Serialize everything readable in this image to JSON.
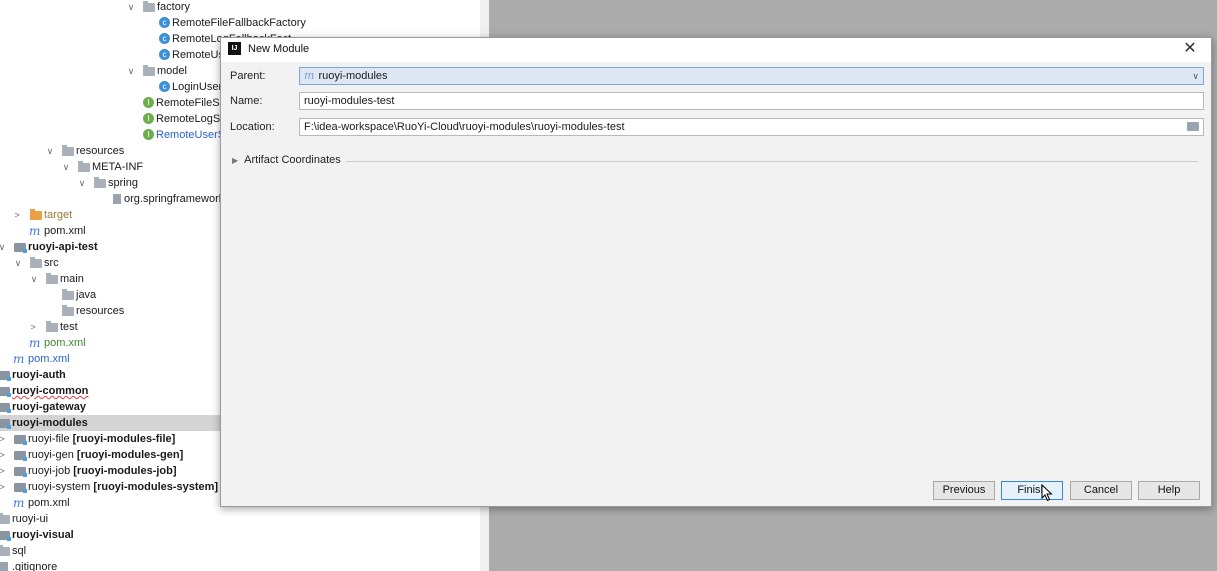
{
  "tree": {
    "rows": [
      {
        "label": "factory"
      },
      {
        "label": "RemoteFileFallbackFactory"
      },
      {
        "label": "RemoteLogFallbackFact"
      },
      {
        "label": "RemoteUs"
      },
      {
        "label": "model"
      },
      {
        "label": "LoginUser"
      },
      {
        "label": "RemoteFileSer"
      },
      {
        "label": "RemoteLogSe"
      },
      {
        "label": "RemoteUserS"
      },
      {
        "label": "resources"
      },
      {
        "label": "META-INF"
      },
      {
        "label": "spring"
      },
      {
        "label": "org.springframework"
      },
      {
        "label": "target"
      },
      {
        "label": "pom.xml"
      },
      {
        "label": "ruoyi-api-test"
      },
      {
        "label": "src"
      },
      {
        "label": "main"
      },
      {
        "label": "java"
      },
      {
        "label": "resources"
      },
      {
        "label": "test"
      },
      {
        "label": "pom.xml"
      },
      {
        "label": "pom.xml"
      },
      {
        "label": "ruoyi-auth"
      },
      {
        "label": "ruoyi-common"
      },
      {
        "label": "ruoyi-gateway"
      },
      {
        "label": "ruoyi-modules"
      },
      {
        "label": "ruoyi-file",
        "module": "[ruoyi-modules-file]"
      },
      {
        "label": "ruoyi-gen",
        "module": "[ruoyi-modules-gen]"
      },
      {
        "label": "ruoyi-job",
        "module": "[ruoyi-modules-job]"
      },
      {
        "label": "ruoyi-system",
        "module": "[ruoyi-modules-system]"
      },
      {
        "label": "pom.xml"
      },
      {
        "label": "ruoyi-ui"
      },
      {
        "label": "ruoyi-visual"
      },
      {
        "label": "sql"
      },
      {
        "label": ".gitignore"
      }
    ]
  },
  "dialog": {
    "title": "New Module",
    "parent_label": "Parent:",
    "parent_value": "ruoyi-modules",
    "name_label": "Name:",
    "name_value": "ruoyi-modules-test",
    "location_label": "Location:",
    "location_value": "F:\\idea-workspace\\RuoYi-Cloud\\ruoyi-modules\\ruoyi-modules-test",
    "artifact_label": "Artifact Coordinates",
    "buttons": {
      "previous": "Previous",
      "finish": "Finish",
      "cancel": "Cancel",
      "help": "Help"
    }
  }
}
